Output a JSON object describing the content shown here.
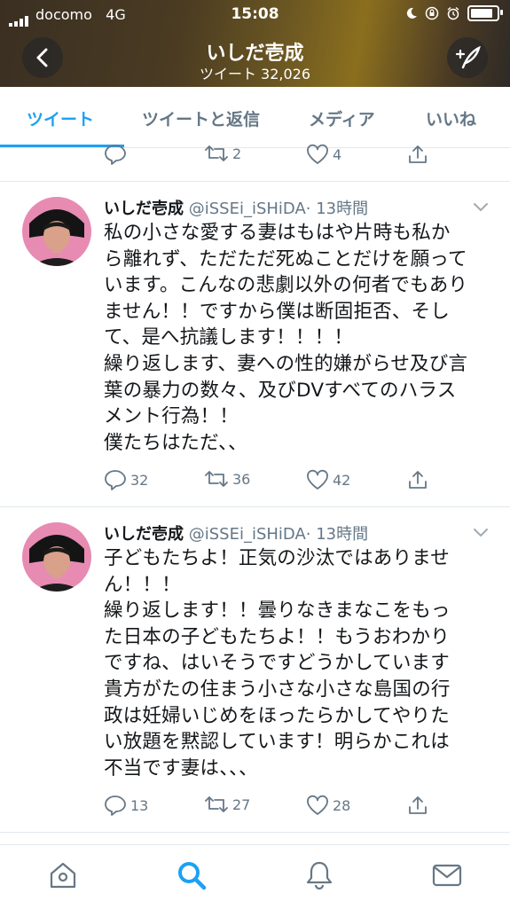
{
  "status_bar": {
    "carrier": "docomo",
    "network": "4G",
    "time": "15:08"
  },
  "header": {
    "title": "いしだ壱成",
    "subtitle": "ツイート 32,026"
  },
  "tabs": [
    {
      "label": "ツイート",
      "active": true
    },
    {
      "label": "ツイートと返信",
      "active": false
    },
    {
      "label": "メディア",
      "active": false
    },
    {
      "label": "いいね",
      "active": false
    }
  ],
  "prev_actions": {
    "retweets": "2",
    "likes": "4"
  },
  "tweets": [
    {
      "name": "いしだ壱成",
      "handle": "@iSSEi_iSHiDA",
      "time": "· 13時間",
      "lines": [
        "私の小さな愛する妻はもはや片時も私か",
        "ら離れず、ただただ死ぬことだけを願って",
        "います。こんなの悲劇以外の何者でもあり",
        "ません！！ですから僕は断固拒否、そし",
        "て、是へ抗議します！！！！",
        "繰り返します、妻への性的嫌がらせ及び言",
        "葉の暴力の数々、及びDVすべてのハラス",
        "メント行為！！",
        "僕たちはただ、、"
      ],
      "replies": "32",
      "retweets": "36",
      "likes": "42"
    },
    {
      "name": "いしだ壱成",
      "handle": "@iSSEi_iSHiDA",
      "time": "· 13時間",
      "lines": [
        "子どもたちよ！正気の沙汰ではありませ",
        "ん！！！",
        "繰り返します！！曇りなきまなこをもっ",
        "た日本の子どもたちよ！！もうおわかり",
        "ですね、はいそうですどうかしています",
        "貴方がたの住まう小さな小さな島国の行",
        "政は妊婦いじめをほったらかしてやりた",
        "い放題を黙認しています！明らかこれは",
        "不当です妻は、、、"
      ],
      "replies": "13",
      "retweets": "27",
      "likes": "28"
    }
  ],
  "colors": {
    "accent": "#1da1f2",
    "secondary_text": "#657786",
    "divider": "#e1e8ed"
  },
  "icons": [
    "back-icon",
    "compose-icon",
    "reply-icon",
    "retweet-icon",
    "like-icon",
    "share-icon",
    "home-icon",
    "search-icon",
    "notifications-icon",
    "messages-icon"
  ]
}
